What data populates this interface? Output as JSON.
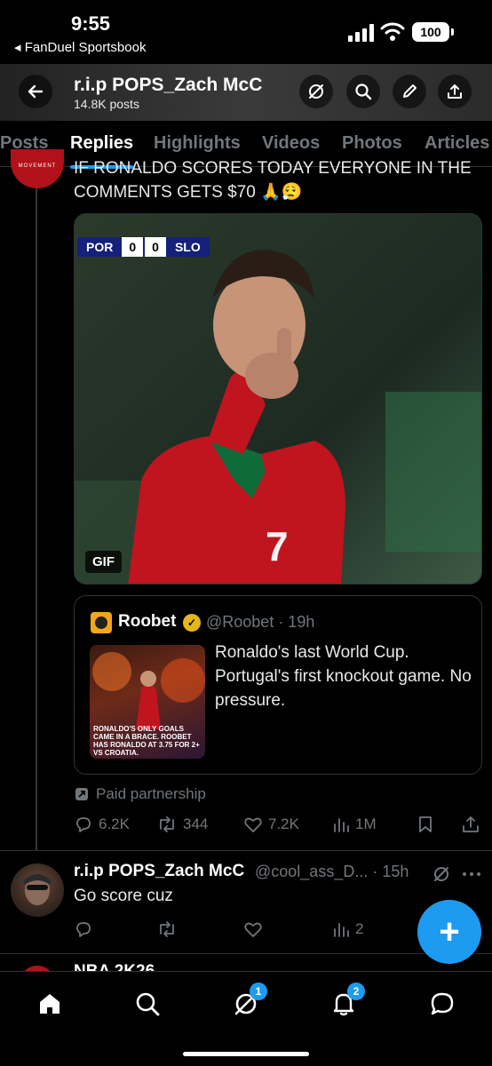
{
  "status_bar": {
    "time": "9:55",
    "back_app": "◂ FanDuel Sportsbook",
    "battery": "100"
  },
  "header": {
    "name": "r.i.p POPS_Zach McC",
    "posts": "14.8K posts"
  },
  "tabs": [
    "Posts",
    "Replies",
    "Highlights",
    "Videos",
    "Photos",
    "Articles"
  ],
  "active_tab": "Replies",
  "post": {
    "avatar_text": "MOVEMENT",
    "text": "IF RONALDO SCORES TODAY EVERYONE IN THE COMMENTS GETS $70 🙏😮‍💨",
    "media": {
      "scorebug": {
        "home": "POR",
        "home_score": "0",
        "away_score": "0",
        "away": "SLO"
      },
      "badge": "GIF"
    },
    "quote": {
      "name": "Roobet",
      "handle": "@Roobet · 19h",
      "text": "Ronaldo's last World Cup. Portugal's first knockout game. No pressure.",
      "image_caption": "RONALDO'S ONLY GOALS CAME IN A BRACE. ROOBET HAS RONALDO AT 3.75 FOR 2+ VS CROATIA."
    },
    "paid_label": "Paid partnership",
    "stats": {
      "replies": "6.2K",
      "reposts": "344",
      "likes": "7.2K",
      "views": "1M"
    }
  },
  "reply": {
    "name": "r.i.p POPS_Zach McC",
    "handle": "@cool_ass_D... · 15h",
    "text": "Go score cuz",
    "views": "2"
  },
  "peek": {
    "text": "NBA 2K26"
  },
  "bottom_nav": {
    "grok_badge": "1",
    "notifications_badge": "2"
  },
  "colors": {
    "accent": "#1d9bf0",
    "muted": "#71767b",
    "background": "#000000"
  }
}
